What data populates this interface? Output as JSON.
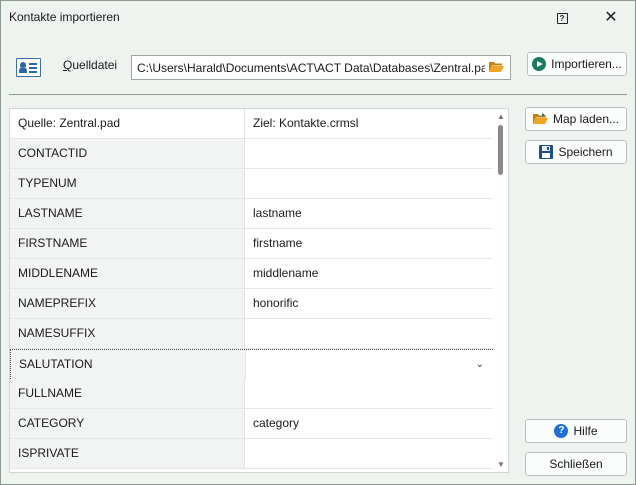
{
  "window": {
    "title": "Kontakte importieren"
  },
  "source": {
    "label_prefix": "",
    "label_underlined": "Q",
    "label_rest": "uelldatei",
    "path": "C:\\Users\\Harald\\Documents\\ACT\\ACT Data\\Databases\\Zentral.pad"
  },
  "buttons": {
    "import": "Importieren...",
    "map_load": "Map laden...",
    "save": "Speichern",
    "help": "Hilfe",
    "close": "Schließen"
  },
  "grid": {
    "headers": [
      "Quelle: Zentral.pad",
      "Ziel: Kontakte.crmsl"
    ],
    "rows": [
      {
        "source": "CONTACTID",
        "target": ""
      },
      {
        "source": "TYPENUM",
        "target": ""
      },
      {
        "source": "LASTNAME",
        "target": "lastname"
      },
      {
        "source": "FIRSTNAME",
        "target": "firstname"
      },
      {
        "source": "MIDDLENAME",
        "target": "middlename"
      },
      {
        "source": "NAMEPREFIX",
        "target": "honorific"
      },
      {
        "source": "NAMESUFFIX",
        "target": ""
      },
      {
        "source": "SALUTATION",
        "target": ""
      },
      {
        "source": "FULLNAME",
        "target": ""
      },
      {
        "source": "CATEGORY",
        "target": "category"
      },
      {
        "source": "ISPRIVATE",
        "target": ""
      }
    ],
    "selected_row": "SALUTATION"
  },
  "icons": {
    "help_titlebar": "help-icon",
    "close_titlebar": "close-icon",
    "contact_card": "contact-card-icon",
    "browse_folder": "folder-open-icon",
    "import": "play-circle-icon",
    "map_load": "folder-open-icon",
    "save": "floppy-disk-icon",
    "help": "help-circle-icon",
    "dropdown": "chevron-down-icon"
  },
  "colors": {
    "window_bg": "#eef3f0",
    "accent_green": "#1b7a62",
    "help_blue": "#1f6fd6",
    "folder_orange": "#e89a1f"
  }
}
